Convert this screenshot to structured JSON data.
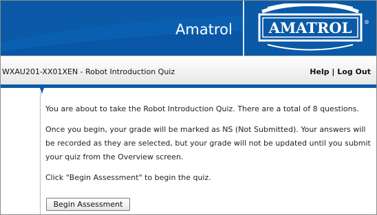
{
  "header": {
    "brand_text": "Amatrol",
    "logo_text": "AMATROL",
    "logo_mark": "®"
  },
  "titlebar": {
    "course_title": "WXAU201-XX01XEN - Robot Introduction Quiz",
    "help_label": "Help",
    "separator": " | ",
    "logout_label": "Log Out"
  },
  "content": {
    "intro": "You are about to take the Robot Introduction Quiz. There are a total of 8 questions.",
    "notice": "Once you begin, your grade will be marked as NS (Not Submitted). Your answers will be recorded as they are selected, but your grade will not be updated until you submit your quiz from the Overview screen.",
    "instruction": "Click \"Begin Assessment\" to begin the quiz.",
    "begin_button": "Begin Assessment"
  },
  "colors": {
    "brand_blue": "#0a5aa7",
    "white": "#ffffff"
  }
}
